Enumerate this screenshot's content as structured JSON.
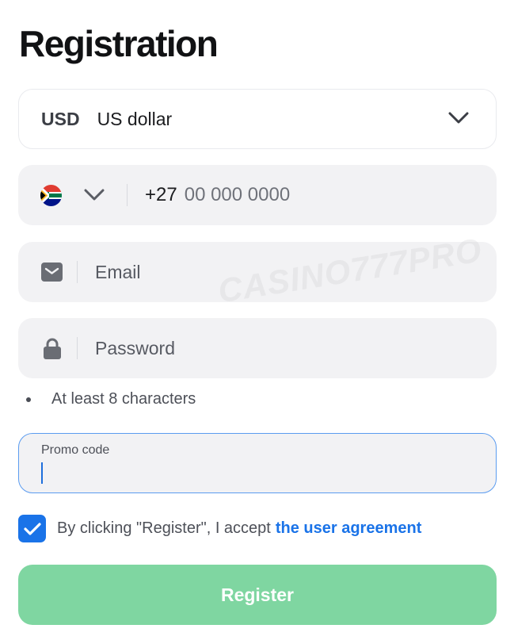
{
  "page": {
    "title": "Registration"
  },
  "currency": {
    "code": "USD",
    "name": "US dollar",
    "chevron_icon": "chevron-down-icon"
  },
  "phone": {
    "country_flag": "south-africa-flag-icon",
    "prefix": "+27",
    "placeholder": "00 000 0000"
  },
  "email": {
    "icon": "envelope-icon",
    "placeholder": "Email"
  },
  "password": {
    "icon": "lock-icon",
    "placeholder": "Password",
    "hint": "At least 8 characters"
  },
  "promo": {
    "label": "Promo code",
    "value": ""
  },
  "agreement": {
    "checked": true,
    "text": "By clicking \"Register\", I accept",
    "link": "the user agreement"
  },
  "register": {
    "label": "Register"
  },
  "watermark": {
    "text": "CASINO777PRO"
  },
  "colors": {
    "accent": "#1a73e8",
    "register_bg": "#7fd6a1",
    "field_bg": "#f2f2f4",
    "focus_border": "#5b9cf0"
  }
}
